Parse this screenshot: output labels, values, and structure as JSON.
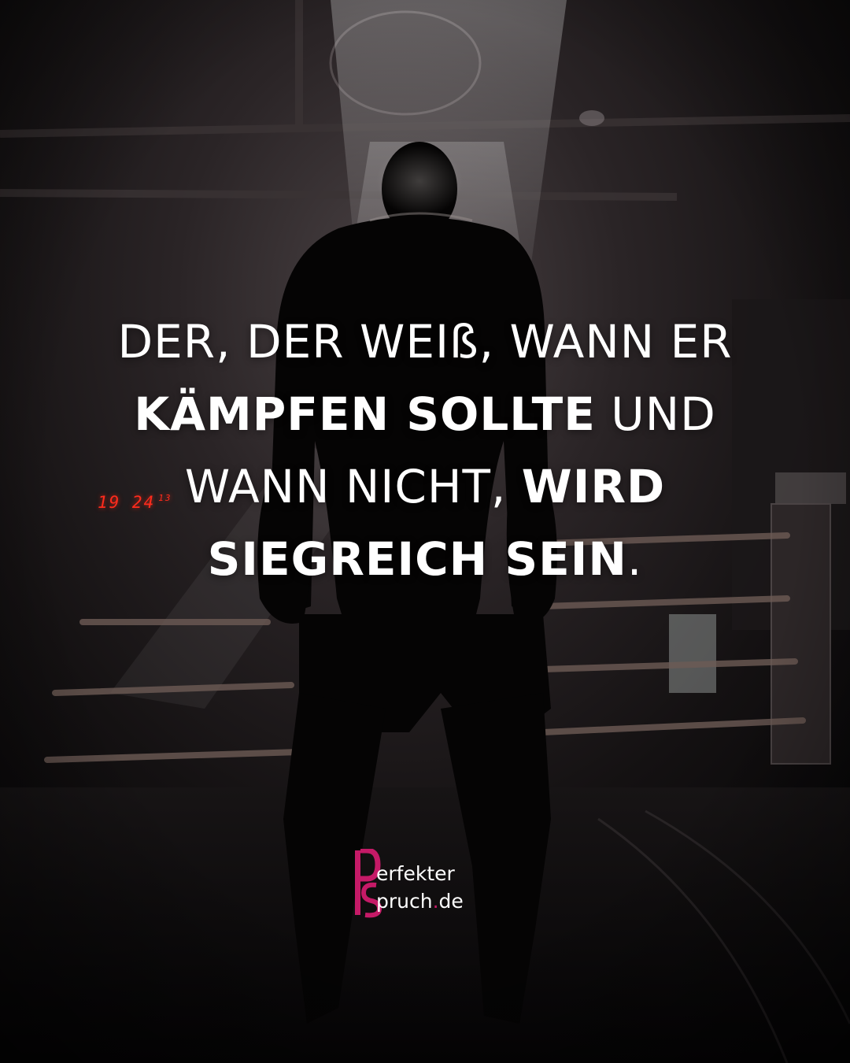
{
  "quote": {
    "line1": "DER, DER WEIß, WANN ER",
    "line2_bold": "KÄMPFEN SOLLTE",
    "line2_rest": " UND",
    "line3_light": "WANN NICHT, ",
    "line3_bold": "WIRD",
    "line4_bold": "SIEGREICH SEIN",
    "line4_end": "."
  },
  "clock": {
    "main": "19 24",
    "seconds": "13"
  },
  "logo": {
    "word1": "erfekter",
    "word2": "pruch",
    "dot": ".",
    "tld": "de",
    "brand_color": "#c51a67"
  },
  "colors": {
    "text": "#ffffff",
    "clock": "#ff2b1c"
  }
}
